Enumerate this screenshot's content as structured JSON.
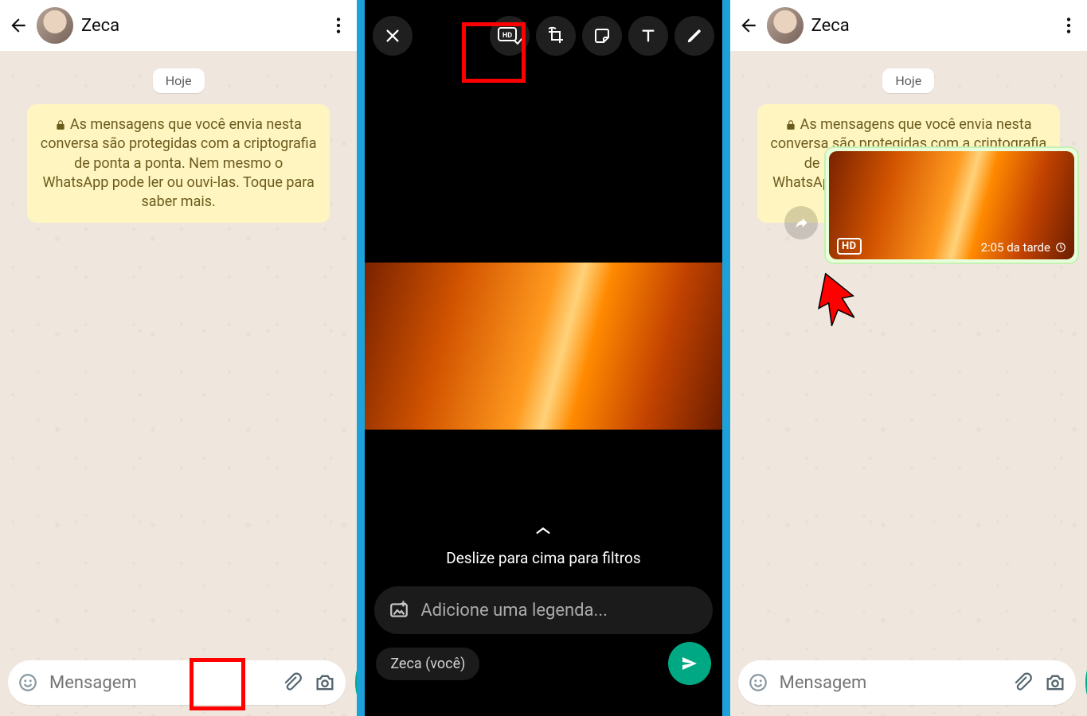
{
  "contact_name": "Zeca",
  "date_pill": "Hoje",
  "encryption_notice": "As mensagens que você envia nesta conversa são protegidas com a criptografia de ponta a ponta. Nem mesmo o WhatsApp pode ler ou ouvi-las. Toque para saber mais.",
  "input_placeholder": "Mensagem",
  "middle": {
    "filters_hint": "Deslize para cima para filtros",
    "caption_placeholder": "Adicione uma legenda...",
    "recipient_chip": "Zeca (você)"
  },
  "right": {
    "hd_badge": "HD",
    "timestamp": "2:05 da tarde"
  },
  "colors": {
    "accent": "#00a884",
    "highlight": "#ff0000",
    "blue": "#1da1db"
  }
}
